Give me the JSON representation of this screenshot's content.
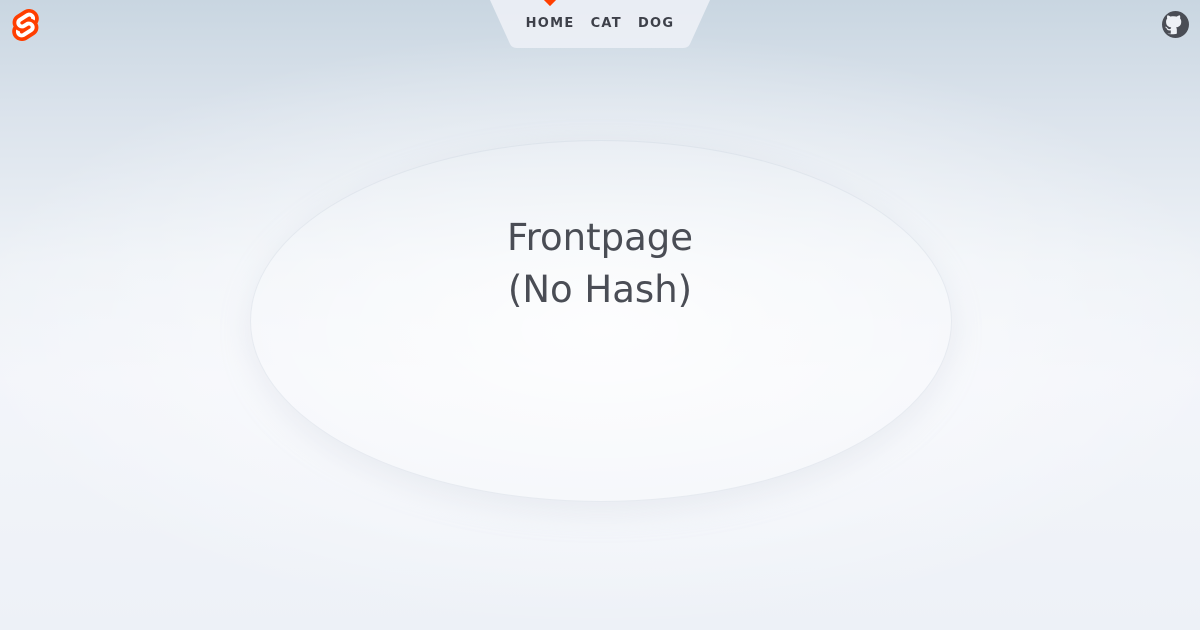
{
  "colors": {
    "accent": "#ff3e00",
    "text": "#4a4d55",
    "nav_text": "#3d4049",
    "nav_background": "#eef1f7"
  },
  "header": {
    "logo_icon": "svelte-logo-icon",
    "github_icon": "github-icon"
  },
  "nav": {
    "items": [
      {
        "label": "HOME",
        "active": true
      },
      {
        "label": "CAT",
        "active": false
      },
      {
        "label": "DOG",
        "active": false
      }
    ]
  },
  "main": {
    "title_line1": "Frontpage",
    "title_line2": "(No Hash)"
  }
}
